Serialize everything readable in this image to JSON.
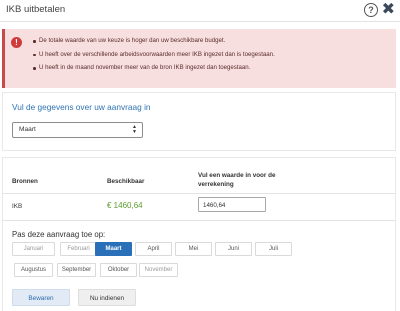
{
  "window": {
    "title": "IKB uitbetalen"
  },
  "titlebar": {
    "help_glyph": "?",
    "close_glyph": "✖"
  },
  "alert": {
    "icon": "!",
    "messages": [
      "De totale waarde van uw keuze is hoger dan uw beschikbare budget.",
      "U heeft over de verschillende arbeidsvoorwaarden meer IKB ingezet dan is toegestaan.",
      "U heeft in de maand november meer van de bron IKB ingezet dan toegestaan."
    ]
  },
  "request": {
    "heading": "Vul de gegevens over uw aanvraag in",
    "month_select": {
      "value": "Maart",
      "arrows": "▲▼"
    }
  },
  "table": {
    "headers": {
      "bronnen": "Bronnen",
      "beschikbaar": "Beschikbaar",
      "vul": "Vul een waarde in voor de verrekening"
    },
    "rows": [
      {
        "bron": "IKB",
        "beschikbaar": "€ 1460,64",
        "waarde": "1460,64"
      }
    ]
  },
  "apply": {
    "label": "Pas deze aanvraag toe op:",
    "months": [
      {
        "label": "Januari",
        "state": "muted"
      },
      {
        "label": "Februari",
        "state": "muted"
      },
      {
        "label": "Maart",
        "state": "active"
      },
      {
        "label": "April",
        "state": "normal"
      },
      {
        "label": "Mei",
        "state": "normal"
      },
      {
        "label": "Juni",
        "state": "normal"
      },
      {
        "label": "Juli",
        "state": "normal"
      },
      {
        "label": "Augustus",
        "state": "normal"
      },
      {
        "label": "September",
        "state": "normal"
      },
      {
        "label": "Oktober",
        "state": "normal"
      },
      {
        "label": "November",
        "state": "muted"
      }
    ]
  },
  "actions": {
    "save": "Bewaren",
    "submit": "Nu indienen"
  },
  "colors": {
    "accent": "#2a70b8",
    "error": "#d03c3c",
    "available": "#5b9b2e"
  }
}
